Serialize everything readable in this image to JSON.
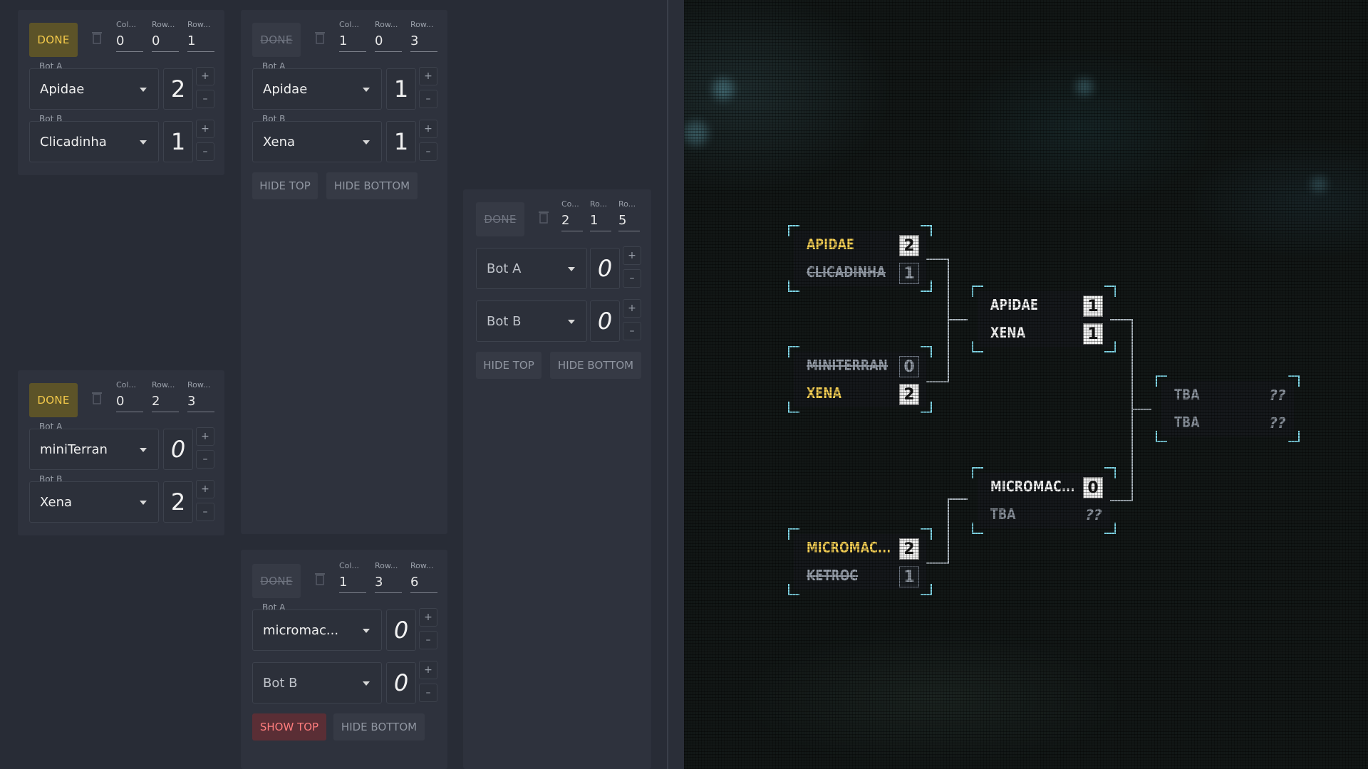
{
  "editor": {
    "matches": [
      {
        "id": "m1",
        "done_label": "DONE",
        "done_active": true,
        "col_label": "Col...",
        "col": "0",
        "row_label": "Row...",
        "row": "0",
        "row2_label": "Row...",
        "row2": "1",
        "bot_a_label": "Bot A",
        "bot_a": "Apidae",
        "score_a": "2",
        "bot_b_label": "Bot B",
        "bot_b": "Clicadinha",
        "score_b": "1"
      },
      {
        "id": "m2",
        "done_label": "DONE",
        "done_active": false,
        "col_label": "Col...",
        "col": "1",
        "row_label": "Row...",
        "row": "0",
        "row2_label": "Row...",
        "row2": "3",
        "bot_a_label": "Bot A",
        "bot_a": "Apidae",
        "score_a": "1",
        "bot_b_label": "Bot B",
        "bot_b": "Xena",
        "score_b": "1",
        "hide_top_label": "HIDE TOP",
        "hide_bottom_label": "HIDE BOTTOM"
      },
      {
        "id": "m3",
        "done_label": "DONE",
        "done_active": false,
        "col_label": "Co...",
        "col": "2",
        "row_label": "Ro...",
        "row": "1",
        "row2_label": "Ro...",
        "row2": "5",
        "bot_a": "Bot A",
        "score_a": "0",
        "bot_b": "Bot B",
        "score_b": "0",
        "hide_top_label": "HIDE TOP",
        "hide_bottom_label": "HIDE BOTTOM"
      },
      {
        "id": "m4",
        "done_label": "DONE",
        "done_active": true,
        "col_label": "Col...",
        "col": "0",
        "row_label": "Row...",
        "row": "2",
        "row2_label": "Row...",
        "row2": "3",
        "bot_a_label": "Bot A",
        "bot_a": "miniTerran",
        "score_a": "0",
        "bot_b_label": "Bot B",
        "bot_b": "Xena",
        "score_b": "2"
      },
      {
        "id": "m5",
        "done_label": "DONE",
        "done_active": false,
        "col_label": "Col...",
        "col": "1",
        "row_label": "Row...",
        "row": "3",
        "row2_label": "Row...",
        "row2": "6",
        "bot_a_label": "Bot A",
        "bot_a": "micromac...",
        "score_a": "0",
        "bot_b": "Bot B",
        "score_b": "0",
        "show_top_label": "SHOW TOP",
        "hide_bottom_label": "HIDE BOTTOM"
      }
    ],
    "stepper": {
      "plus": "+",
      "minus": "–"
    }
  },
  "bracket": {
    "matches": [
      {
        "top": {
          "name": "APIDAE",
          "score": "2",
          "state": "winner"
        },
        "bottom": {
          "name": "CLICADINHA",
          "score": "1",
          "state": "loser"
        }
      },
      {
        "top": {
          "name": "MINITERRAN",
          "score": "0",
          "state": "loser"
        },
        "bottom": {
          "name": "XENA",
          "score": "2",
          "state": "winner"
        }
      },
      {
        "top": {
          "name": "MICROMAC...",
          "score": "2",
          "state": "winner"
        },
        "bottom": {
          "name": "KETROC",
          "score": "1",
          "state": "loser"
        }
      },
      {
        "top": {
          "name": "APIDAE",
          "score": "1",
          "state": "neutral"
        },
        "bottom": {
          "name": "XENA",
          "score": "1",
          "state": "neutral"
        }
      },
      {
        "top": {
          "name": "MICROMAC...",
          "score": "0",
          "state": "neutral"
        },
        "bottom": {
          "name": "TBA",
          "score": "??",
          "state": "tba"
        }
      },
      {
        "top": {
          "name": "TBA",
          "score": "??",
          "state": "tba"
        },
        "bottom": {
          "name": "TBA",
          "score": "??",
          "state": "tba"
        }
      }
    ]
  },
  "colors": {
    "done_active_bg": "#5c5328",
    "done_active_text": "#f3c94a",
    "winner_text": "#f4cf55",
    "corner_accent": "#7fd6e6",
    "alert_text": "#ff7d7d"
  }
}
